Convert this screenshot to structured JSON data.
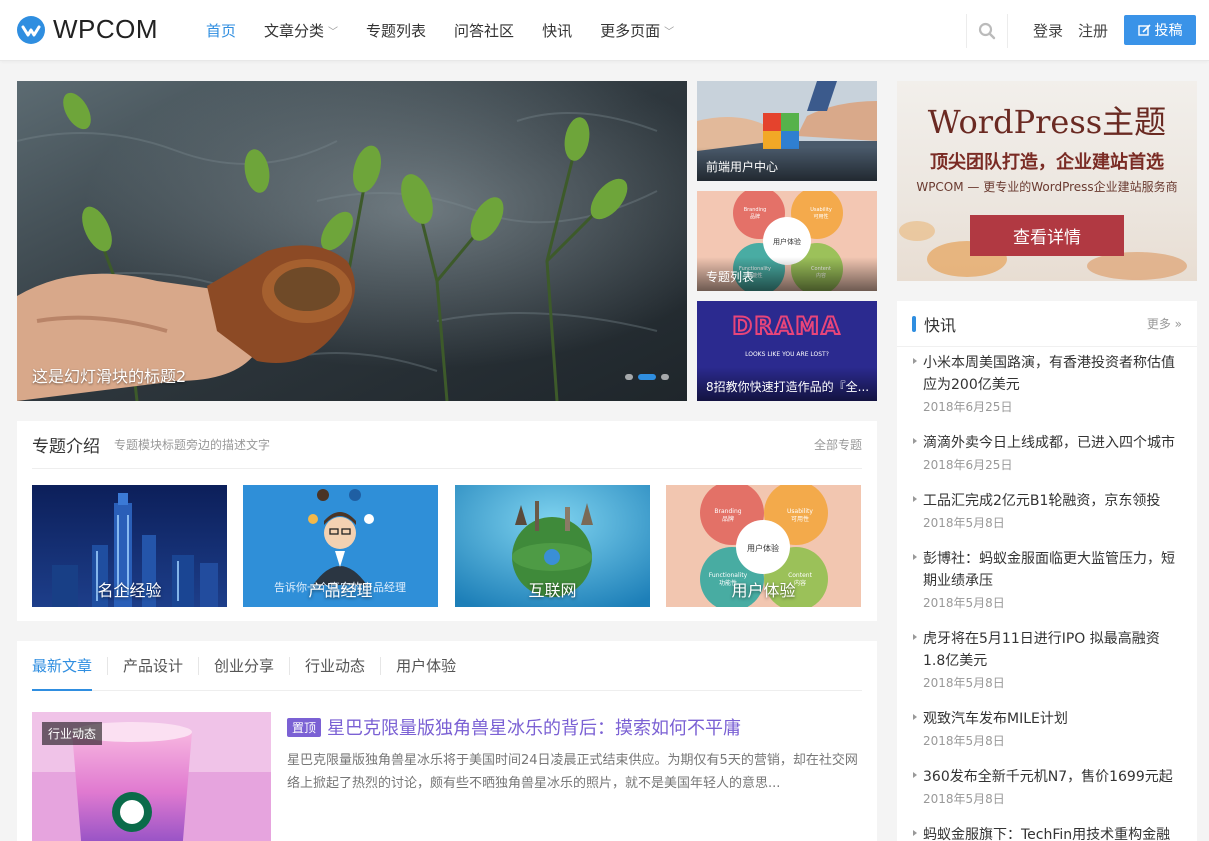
{
  "brand": {
    "logo_text": "WPCOM",
    "accent": "#2f8ee0"
  },
  "nav": {
    "items": [
      {
        "label": "首页",
        "active": true,
        "dropdown": false
      },
      {
        "label": "文章分类",
        "active": false,
        "dropdown": true
      },
      {
        "label": "专题列表",
        "active": false,
        "dropdown": false
      },
      {
        "label": "问答社区",
        "active": false,
        "dropdown": false
      },
      {
        "label": "快讯",
        "active": false,
        "dropdown": false
      },
      {
        "label": "更多页面",
        "active": false,
        "dropdown": true
      }
    ],
    "login": "登录",
    "register": "注册",
    "post_button": "投稿"
  },
  "slider": {
    "title": "这是幻灯滑块的标题2",
    "active_dot": 2,
    "dot_count": 3
  },
  "side_thumbs": [
    {
      "caption": "前端用户中心"
    },
    {
      "caption": "专题列表"
    },
    {
      "caption": "8招教你快速打造作品的『全..."
    }
  ],
  "thumb_text": {
    "drama": "DRAMA",
    "drama_sub": "LOOKS LIKE YOU ARE LOST?",
    "ux_center": "用户体验",
    "branding": "Branding",
    "branding_cn": "品牌",
    "usability": "Usability",
    "usability_cn": "可用性",
    "functionality": "Functionality",
    "functionality_cn": "功能性",
    "content": "Content",
    "content_cn": "内容"
  },
  "ad": {
    "title": "WordPress主题",
    "subtitle": "顶尖团队打造，企业建站首选",
    "description": "WPCOM — 更专业的WordPress企业建站服务商",
    "button": "查看详情"
  },
  "news": {
    "title": "快讯",
    "more": "更多 »",
    "items": [
      {
        "text": "小米本周美国路演，有香港投资者称估值应为200亿美元",
        "date": "2018年6月25日"
      },
      {
        "text": "滴滴外卖今日上线成都，已进入四个城市",
        "date": "2018年6月25日"
      },
      {
        "text": "工品汇完成2亿元B1轮融资，京东领投",
        "date": "2018年5月8日"
      },
      {
        "text": "彭博社：蚂蚁金服面临更大监管压力，短期业绩承压",
        "date": "2018年5月8日"
      },
      {
        "text": "虎牙将在5月11日进行IPO 拟最高融资1.8亿美元",
        "date": "2018年5月8日"
      },
      {
        "text": "观致汽车发布MILE计划",
        "date": "2018年5月8日"
      },
      {
        "text": "360发布全新千元机N7，售价1699元起",
        "date": "2018年5月8日"
      },
      {
        "text": "蚂蚁金服旗下：TechFin用技术重构金融服务",
        "date": ""
      }
    ]
  },
  "topics": {
    "title": "专题介绍",
    "desc": "专题模块标题旁边的描述文字",
    "more": "全部专题",
    "items": [
      {
        "label": "名企经验"
      },
      {
        "label": "产品经理"
      },
      {
        "label": "互联网"
      },
      {
        "label": "用户体验"
      }
    ],
    "pm_overlay": "告诉你一个真实的产品经理"
  },
  "articles": {
    "tabs": [
      "最新文章",
      "产品设计",
      "创业分享",
      "行业动态",
      "用户体验"
    ],
    "active_tab": 0,
    "featured": {
      "category": "行业动态",
      "sticky": "置顶",
      "title": "星巴克限量版独角兽星冰乐的背后：摸索如何不平庸",
      "excerpt": "星巴克限量版独角兽星冰乐将于美国时间24日凌晨正式结束供应。为期仅有5天的营销，却在社交网络上掀起了热烈的讨论，颇有些不晒独角兽星冰乐的照片，就不是美国年轻人的意思..."
    }
  }
}
